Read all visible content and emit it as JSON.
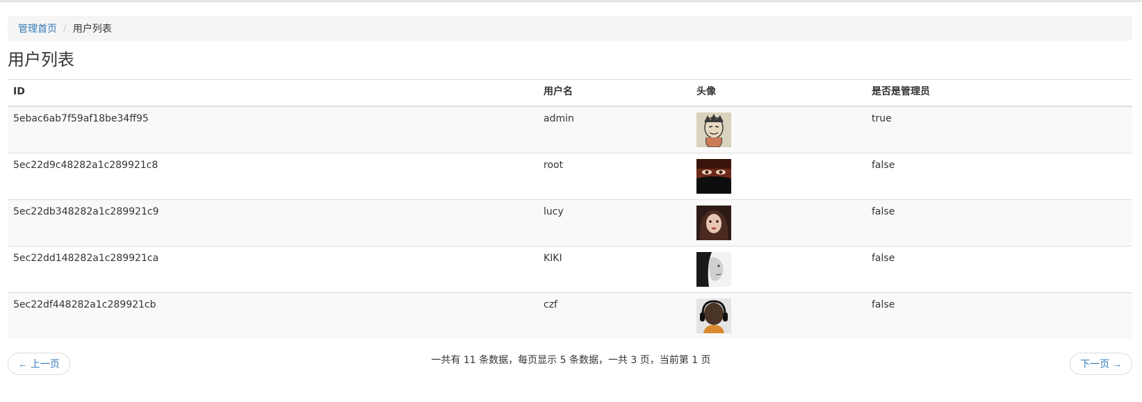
{
  "breadcrumb": {
    "home": "管理首页",
    "separator": "/",
    "current": "用户列表"
  },
  "page_title": "用户列表",
  "table": {
    "headers": [
      "ID",
      "用户名",
      "头像",
      "是否是管理员"
    ],
    "rows": [
      {
        "id": "5ebac6ab7f59af18be34ff95",
        "username": "admin",
        "avatar": "anime-avatar-image",
        "is_admin": "true"
      },
      {
        "id": "5ec22d9c48282a1c289921c8",
        "username": "root",
        "avatar": "masked-woman-avatar-image",
        "is_admin": "false"
      },
      {
        "id": "5ec22db348282a1c289921c9",
        "username": "lucy",
        "avatar": "woman-portrait-avatar-image",
        "is_admin": "false"
      },
      {
        "id": "5ec22dd148282a1c289921ca",
        "username": "KIKI",
        "avatar": "bw-profile-avatar-image",
        "is_admin": "false"
      },
      {
        "id": "5ec22df448282a1c289921cb",
        "username": "czf",
        "avatar": "headphones-avatar-image",
        "is_admin": "false"
      }
    ]
  },
  "pager": {
    "prev": "← 上一页",
    "next": "下一页 →",
    "info": "一共有 11 条数据，每页显示 5 条数据，一共 3 页，当前第 1 页"
  },
  "colors": {
    "link": "#337ab7",
    "breadcrumb_bg": "#f5f5f5",
    "stripe": "#f9f9f9",
    "border": "#dddddd"
  }
}
